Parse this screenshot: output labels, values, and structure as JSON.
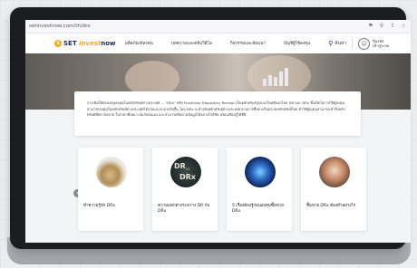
{
  "browser": {
    "url": "setinvestnow.com/th/drx"
  },
  "site": {
    "logo_mark": "S",
    "logo_set": "SET",
    "logo_invest": "invest",
    "logo_now": "now",
    "nav": [
      "ผลิตภัณฑ์ลงทุน",
      "บทความและคลิปวิดีโอ",
      "กิจกรรมและสัมมนา",
      "บัญชีผู้ใช้ลงทุน"
    ],
    "search_label": "ค้นหา",
    "user_line1": "ลืมรหัส",
    "user_line2": "เข้าสู่ระบบ"
  },
  "content": {
    "description": "การเปิดให้นักลงทุนลงทุนในหลักทรัพย์ต่างประเทศ ... \"DRx\" หรือ Fractional Depositary Receipt เป็นหลักทรัพย์รูปแบบใหม่ที่ออกโดย DR และ DRx ซึ่งเปิดโอกาสให้ผู้ลงทุนสามารถลงทุนในหลักทรัพย์ต่างประเทศได้ง่ายและสะดวกยิ่งขึ้น โดย DRx จะอ้างอิงหลักทรัพย์ต่างประเทศ ผ่านการซื้อขายในตลาดหลักทรัพย์ไทย ทำให้ผู้ลงทุนสามารถเข้าถึงหลักทรัพย์ที่หลากหลาย ในราคาที่เหมาะสมกับตนเอง และสามารถติดตามข้อมูลได้อย่างใกล้ชิด พร้อมเรียนรู้ได้ที่นี่"
  },
  "cards": [
    {
      "title": "ทำความรู้จัก DRx"
    },
    {
      "title": "ความแตกต่างระหว่าง DR กับ DRx",
      "thumb_text_1": "DR",
      "thumb_text_2": "vs",
      "thumb_text_3": "DRx"
    },
    {
      "title": "5 เรื่องต้องรู้ก่อนลงทุนซื้อขาย DRx"
    },
    {
      "title": "ซื้อขาย DRx ต้องทำอย่างไร"
    }
  ],
  "arrows": {
    "prev": "‹",
    "next": "›"
  },
  "colors": {
    "brand_navy": "#1a2a5c",
    "brand_orange": "#f4a81c"
  }
}
